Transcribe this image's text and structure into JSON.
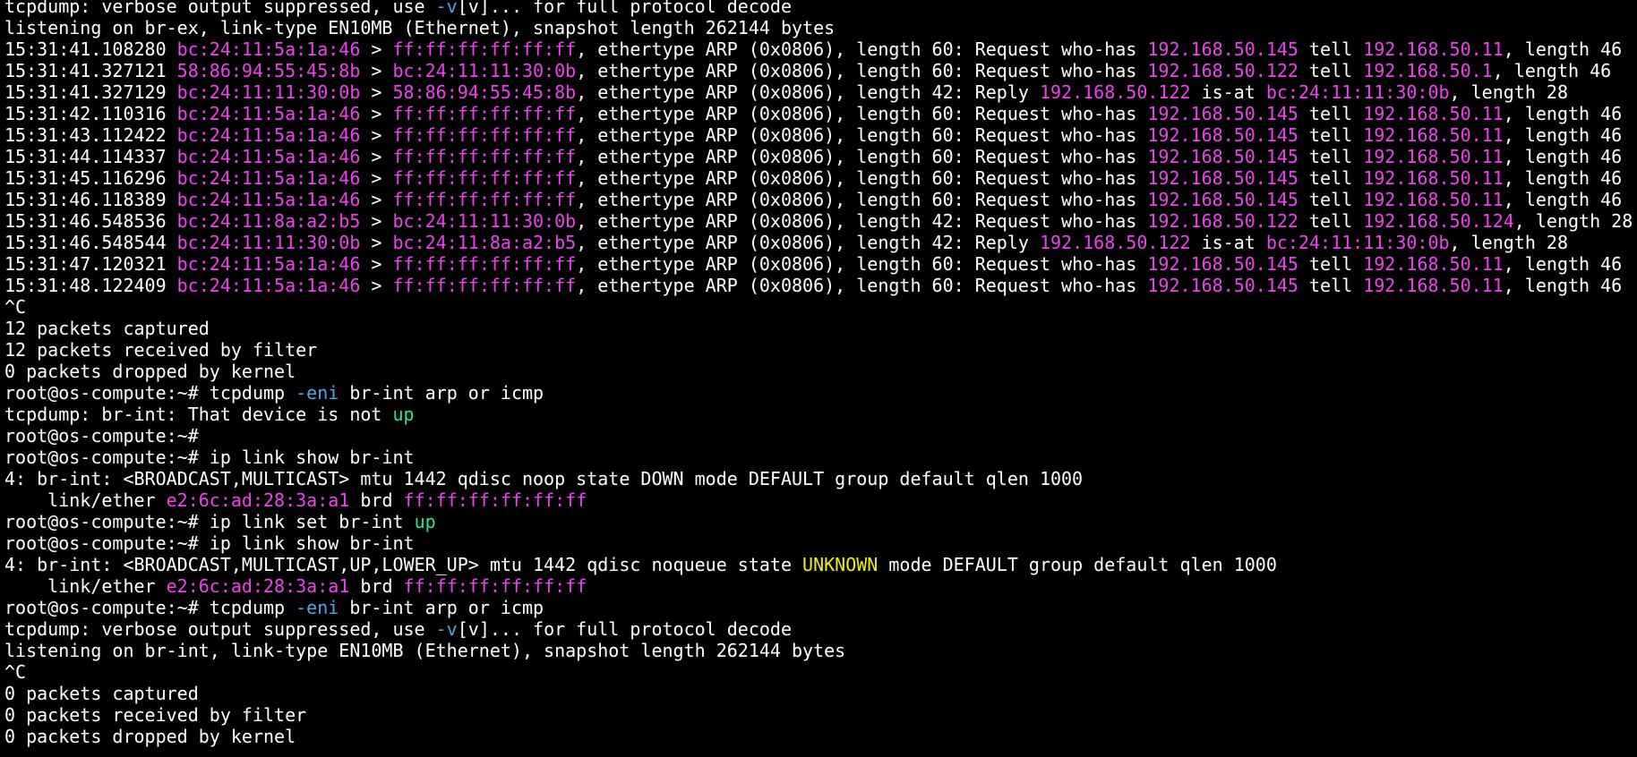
{
  "terminal": {
    "colors": {
      "background": "#000000",
      "default": "#ffffff",
      "magenta": "#f040f0",
      "cyan": "#4aa8e6",
      "green": "#2ee58a",
      "yellow": "#f0f000"
    },
    "lines": [
      [
        {
          "t": "tcpdump: verbose output suppressed, use ",
          "c": "default"
        },
        {
          "t": "-v",
          "c": "cyan"
        },
        {
          "t": "[v]... for full protocol decode",
          "c": "default"
        }
      ],
      [
        {
          "t": "listening on br-ex, link-type EN10MB (Ethernet), snapshot length 262144 bytes",
          "c": "default"
        }
      ],
      [
        {
          "t": "15:31:41.108280 ",
          "c": "default"
        },
        {
          "t": "bc:24:11:5a:1a:46",
          "c": "magenta"
        },
        {
          "t": " > ",
          "c": "default"
        },
        {
          "t": "ff:ff:ff:ff:ff:ff",
          "c": "magenta"
        },
        {
          "t": ", ethertype ARP (0x0806), length 60: Request who-has ",
          "c": "default"
        },
        {
          "t": "192.168.50.145",
          "c": "magenta"
        },
        {
          "t": " tell ",
          "c": "default"
        },
        {
          "t": "192.168.50.11",
          "c": "magenta"
        },
        {
          "t": ", length 46",
          "c": "default"
        }
      ],
      [
        {
          "t": "15:31:41.327121 ",
          "c": "default"
        },
        {
          "t": "58:86:94:55:45:8b",
          "c": "magenta"
        },
        {
          "t": " > ",
          "c": "default"
        },
        {
          "t": "bc:24:11:11:30:0b",
          "c": "magenta"
        },
        {
          "t": ", ethertype ARP (0x0806), length 60: Request who-has ",
          "c": "default"
        },
        {
          "t": "192.168.50.122",
          "c": "magenta"
        },
        {
          "t": " tell ",
          "c": "default"
        },
        {
          "t": "192.168.50.1",
          "c": "magenta"
        },
        {
          "t": ", length 46",
          "c": "default"
        }
      ],
      [
        {
          "t": "15:31:41.327129 ",
          "c": "default"
        },
        {
          "t": "bc:24:11:11:30:0b",
          "c": "magenta"
        },
        {
          "t": " > ",
          "c": "default"
        },
        {
          "t": "58:86:94:55:45:8b",
          "c": "magenta"
        },
        {
          "t": ", ethertype ARP (0x0806), length 42: Reply ",
          "c": "default"
        },
        {
          "t": "192.168.50.122",
          "c": "magenta"
        },
        {
          "t": " is-at ",
          "c": "default"
        },
        {
          "t": "bc:24:11:11:30:0b",
          "c": "magenta"
        },
        {
          "t": ", length 28",
          "c": "default"
        }
      ],
      [
        {
          "t": "15:31:42.110316 ",
          "c": "default"
        },
        {
          "t": "bc:24:11:5a:1a:46",
          "c": "magenta"
        },
        {
          "t": " > ",
          "c": "default"
        },
        {
          "t": "ff:ff:ff:ff:ff:ff",
          "c": "magenta"
        },
        {
          "t": ", ethertype ARP (0x0806), length 60: Request who-has ",
          "c": "default"
        },
        {
          "t": "192.168.50.145",
          "c": "magenta"
        },
        {
          "t": " tell ",
          "c": "default"
        },
        {
          "t": "192.168.50.11",
          "c": "magenta"
        },
        {
          "t": ", length 46",
          "c": "default"
        }
      ],
      [
        {
          "t": "15:31:43.112422 ",
          "c": "default"
        },
        {
          "t": "bc:24:11:5a:1a:46",
          "c": "magenta"
        },
        {
          "t": " > ",
          "c": "default"
        },
        {
          "t": "ff:ff:ff:ff:ff:ff",
          "c": "magenta"
        },
        {
          "t": ", ethertype ARP (0x0806), length 60: Request who-has ",
          "c": "default"
        },
        {
          "t": "192.168.50.145",
          "c": "magenta"
        },
        {
          "t": " tell ",
          "c": "default"
        },
        {
          "t": "192.168.50.11",
          "c": "magenta"
        },
        {
          "t": ", length 46",
          "c": "default"
        }
      ],
      [
        {
          "t": "15:31:44.114337 ",
          "c": "default"
        },
        {
          "t": "bc:24:11:5a:1a:46",
          "c": "magenta"
        },
        {
          "t": " > ",
          "c": "default"
        },
        {
          "t": "ff:ff:ff:ff:ff:ff",
          "c": "magenta"
        },
        {
          "t": ", ethertype ARP (0x0806), length 60: Request who-has ",
          "c": "default"
        },
        {
          "t": "192.168.50.145",
          "c": "magenta"
        },
        {
          "t": " tell ",
          "c": "default"
        },
        {
          "t": "192.168.50.11",
          "c": "magenta"
        },
        {
          "t": ", length 46",
          "c": "default"
        }
      ],
      [
        {
          "t": "15:31:45.116296 ",
          "c": "default"
        },
        {
          "t": "bc:24:11:5a:1a:46",
          "c": "magenta"
        },
        {
          "t": " > ",
          "c": "default"
        },
        {
          "t": "ff:ff:ff:ff:ff:ff",
          "c": "magenta"
        },
        {
          "t": ", ethertype ARP (0x0806), length 60: Request who-has ",
          "c": "default"
        },
        {
          "t": "192.168.50.145",
          "c": "magenta"
        },
        {
          "t": " tell ",
          "c": "default"
        },
        {
          "t": "192.168.50.11",
          "c": "magenta"
        },
        {
          "t": ", length 46",
          "c": "default"
        }
      ],
      [
        {
          "t": "15:31:46.118389 ",
          "c": "default"
        },
        {
          "t": "bc:24:11:5a:1a:46",
          "c": "magenta"
        },
        {
          "t": " > ",
          "c": "default"
        },
        {
          "t": "ff:ff:ff:ff:ff:ff",
          "c": "magenta"
        },
        {
          "t": ", ethertype ARP (0x0806), length 60: Request who-has ",
          "c": "default"
        },
        {
          "t": "192.168.50.145",
          "c": "magenta"
        },
        {
          "t": " tell ",
          "c": "default"
        },
        {
          "t": "192.168.50.11",
          "c": "magenta"
        },
        {
          "t": ", length 46",
          "c": "default"
        }
      ],
      [
        {
          "t": "15:31:46.548536 ",
          "c": "default"
        },
        {
          "t": "bc:24:11:8a:a2:b5",
          "c": "magenta"
        },
        {
          "t": " > ",
          "c": "default"
        },
        {
          "t": "bc:24:11:11:30:0b",
          "c": "magenta"
        },
        {
          "t": ", ethertype ARP (0x0806), length 42: Request who-has ",
          "c": "default"
        },
        {
          "t": "192.168.50.122",
          "c": "magenta"
        },
        {
          "t": " tell ",
          "c": "default"
        },
        {
          "t": "192.168.50.124",
          "c": "magenta"
        },
        {
          "t": ", length 28",
          "c": "default"
        }
      ],
      [
        {
          "t": "15:31:46.548544 ",
          "c": "default"
        },
        {
          "t": "bc:24:11:11:30:0b",
          "c": "magenta"
        },
        {
          "t": " > ",
          "c": "default"
        },
        {
          "t": "bc:24:11:8a:a2:b5",
          "c": "magenta"
        },
        {
          "t": ", ethertype ARP (0x0806), length 42: Reply ",
          "c": "default"
        },
        {
          "t": "192.168.50.122",
          "c": "magenta"
        },
        {
          "t": " is-at ",
          "c": "default"
        },
        {
          "t": "bc:24:11:11:30:0b",
          "c": "magenta"
        },
        {
          "t": ", length 28",
          "c": "default"
        }
      ],
      [
        {
          "t": "15:31:47.120321 ",
          "c": "default"
        },
        {
          "t": "bc:24:11:5a:1a:46",
          "c": "magenta"
        },
        {
          "t": " > ",
          "c": "default"
        },
        {
          "t": "ff:ff:ff:ff:ff:ff",
          "c": "magenta"
        },
        {
          "t": ", ethertype ARP (0x0806), length 60: Request who-has ",
          "c": "default"
        },
        {
          "t": "192.168.50.145",
          "c": "magenta"
        },
        {
          "t": " tell ",
          "c": "default"
        },
        {
          "t": "192.168.50.11",
          "c": "magenta"
        },
        {
          "t": ", length 46",
          "c": "default"
        }
      ],
      [
        {
          "t": "15:31:48.122409 ",
          "c": "default"
        },
        {
          "t": "bc:24:11:5a:1a:46",
          "c": "magenta"
        },
        {
          "t": " > ",
          "c": "default"
        },
        {
          "t": "ff:ff:ff:ff:ff:ff",
          "c": "magenta"
        },
        {
          "t": ", ethertype ARP (0x0806), length 60: Request who-has ",
          "c": "default"
        },
        {
          "t": "192.168.50.145",
          "c": "magenta"
        },
        {
          "t": " tell ",
          "c": "default"
        },
        {
          "t": "192.168.50.11",
          "c": "magenta"
        },
        {
          "t": ", length 46",
          "c": "default"
        }
      ],
      [
        {
          "t": "^C",
          "c": "default"
        }
      ],
      [
        {
          "t": "12 packets captured",
          "c": "default"
        }
      ],
      [
        {
          "t": "12 packets received by filter",
          "c": "default"
        }
      ],
      [
        {
          "t": "0 packets dropped by kernel",
          "c": "default"
        }
      ],
      [
        {
          "t": "root@os-compute:~# tcpdump ",
          "c": "default"
        },
        {
          "t": "-eni",
          "c": "cyan"
        },
        {
          "t": " br-int arp or icmp",
          "c": "default"
        }
      ],
      [
        {
          "t": "tcpdump: br-int: That device is not ",
          "c": "default"
        },
        {
          "t": "up",
          "c": "green"
        }
      ],
      [
        {
          "t": "root@os-compute:~#",
          "c": "default"
        }
      ],
      [
        {
          "t": "root@os-compute:~# ip link show br-int",
          "c": "default"
        }
      ],
      [
        {
          "t": "4: br-int: <BROADCAST,MULTICAST> mtu 1442 qdisc noop state DOWN mode DEFAULT group default qlen 1000",
          "c": "default"
        }
      ],
      [
        {
          "t": "    link/ether ",
          "c": "default"
        },
        {
          "t": "e2:6c:ad:28:3a:a1",
          "c": "magenta"
        },
        {
          "t": " brd ",
          "c": "default"
        },
        {
          "t": "ff:ff:ff:ff:ff:ff",
          "c": "magenta"
        }
      ],
      [
        {
          "t": "root@os-compute:~# ip link set br-int ",
          "c": "default"
        },
        {
          "t": "up",
          "c": "green"
        }
      ],
      [
        {
          "t": "root@os-compute:~# ip link show br-int",
          "c": "default"
        }
      ],
      [
        {
          "t": "4: br-int: <BROADCAST,MULTICAST,UP,LOWER_UP> mtu 1442 qdisc noqueue state ",
          "c": "default"
        },
        {
          "t": "UNKNOWN",
          "c": "yellow"
        },
        {
          "t": " mode DEFAULT group default qlen 1000",
          "c": "default"
        }
      ],
      [
        {
          "t": "    link/ether ",
          "c": "default"
        },
        {
          "t": "e2:6c:ad:28:3a:a1",
          "c": "magenta"
        },
        {
          "t": " brd ",
          "c": "default"
        },
        {
          "t": "ff:ff:ff:ff:ff:ff",
          "c": "magenta"
        }
      ],
      [
        {
          "t": "root@os-compute:~# tcpdump ",
          "c": "default"
        },
        {
          "t": "-eni",
          "c": "cyan"
        },
        {
          "t": " br-int arp or icmp",
          "c": "default"
        }
      ],
      [
        {
          "t": "tcpdump: verbose output suppressed, use ",
          "c": "default"
        },
        {
          "t": "-v",
          "c": "cyan"
        },
        {
          "t": "[v]... for full protocol decode",
          "c": "default"
        }
      ],
      [
        {
          "t": "listening on br-int, link-type EN10MB (Ethernet), snapshot length 262144 bytes",
          "c": "default"
        }
      ],
      [
        {
          "t": "^C",
          "c": "default"
        }
      ],
      [
        {
          "t": "0 packets captured",
          "c": "default"
        }
      ],
      [
        {
          "t": "0 packets received by filter",
          "c": "default"
        }
      ],
      [
        {
          "t": "0 packets dropped by kernel",
          "c": "default"
        }
      ]
    ]
  }
}
